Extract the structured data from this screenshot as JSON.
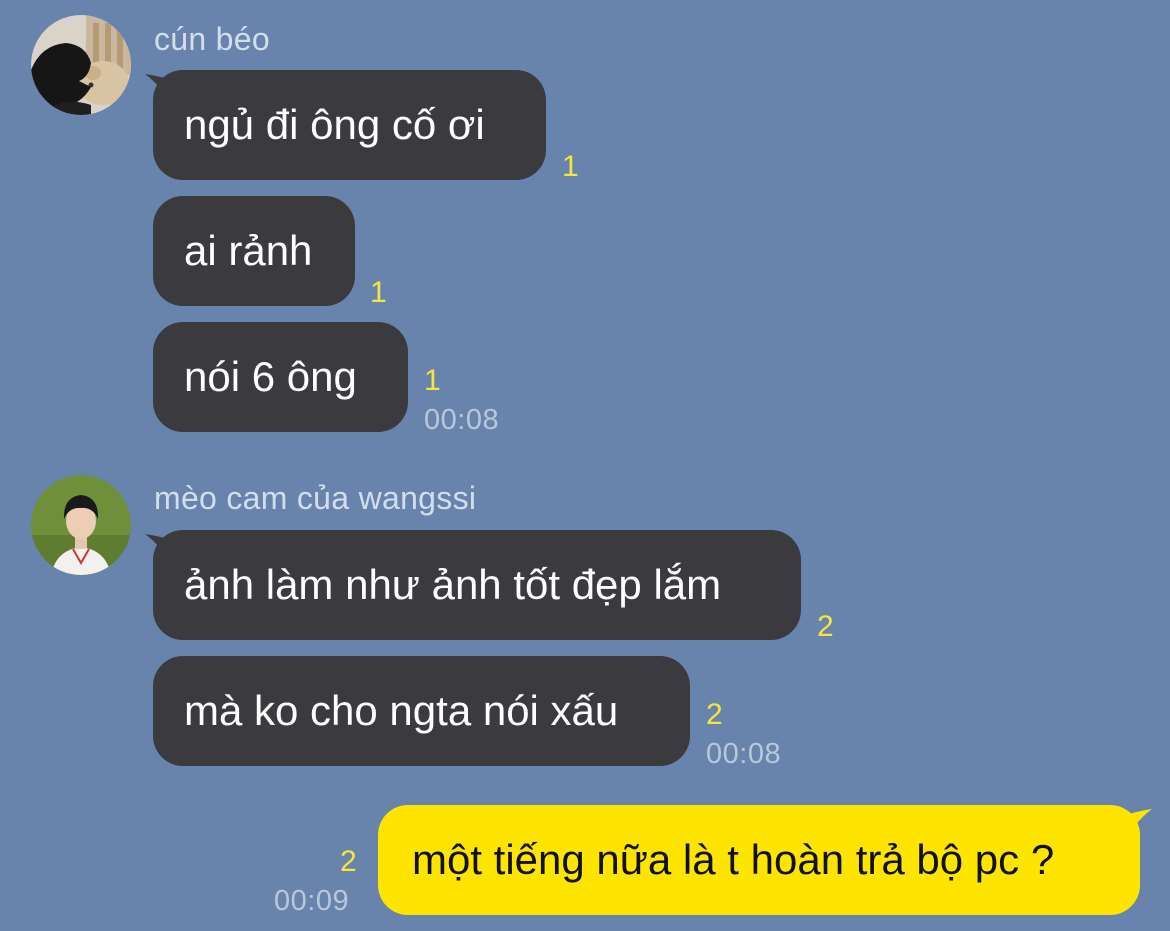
{
  "colors": {
    "background": "#6884ac",
    "incoming_bubble": "#3b3b3f",
    "outgoing_bubble": "#fee500",
    "read_count": "#f6e53a",
    "timestamp": "#b8c7dc",
    "sender_name": "#d3deec"
  },
  "groups": [
    {
      "sender": "cún béo",
      "avatar": "avatar-photo",
      "messages": [
        {
          "text": "ngủ đi ông cố ơi",
          "read_count": "1"
        },
        {
          "text": "ai rảnh",
          "read_count": "1"
        },
        {
          "text": "nói 6 ông",
          "read_count": "1"
        }
      ],
      "time": "00:08"
    },
    {
      "sender": "mèo cam của wangssi",
      "avatar": "avatar-photo",
      "messages": [
        {
          "text": "ảnh làm như ảnh tốt đẹp lắm",
          "read_count": "2"
        },
        {
          "text": "mà ko cho ngta nói xấu",
          "read_count": "2"
        }
      ],
      "time": "00:08"
    }
  ],
  "outgoing": {
    "text": "một tiếng nữa là t hoàn trả bộ pc ?",
    "read_count": "2",
    "time": "00:09"
  }
}
